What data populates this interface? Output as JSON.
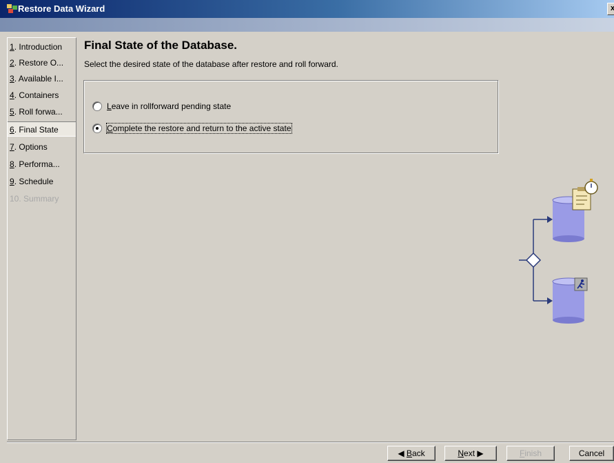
{
  "window": {
    "title": "Restore Data Wizard",
    "close_glyph": "x"
  },
  "nav": {
    "items": [
      {
        "num": "1",
        "rest": ". Introduction",
        "state": "normal"
      },
      {
        "num": "2",
        "rest": ". Restore O...",
        "state": "normal"
      },
      {
        "num": "3",
        "rest": ". Available I...",
        "state": "normal"
      },
      {
        "num": "4",
        "rest": ". Containers",
        "state": "normal"
      },
      {
        "num": "5",
        "rest": ". Roll forwa...",
        "state": "normal"
      },
      {
        "num": "6",
        "rest": ". Final State",
        "state": "selected"
      },
      {
        "num": "7",
        "rest": ". Options",
        "state": "normal"
      },
      {
        "num": "8",
        "rest": ". Performa...",
        "state": "normal"
      },
      {
        "num": "9",
        "rest": ". Schedule",
        "state": "normal"
      },
      {
        "num": "",
        "rest": "10. Summary",
        "state": "disabled"
      }
    ]
  },
  "page": {
    "heading": "Final State of the Database.",
    "subtitle": "Select the desired state of the database after restore and roll forward."
  },
  "options": {
    "leave": {
      "key": "L",
      "rest": "eave in rollforward pending state",
      "checked": false
    },
    "complete": {
      "key": "C",
      "rest": "omplete the restore and return to the active state",
      "checked": true
    }
  },
  "buttons": {
    "back": {
      "prefix": "◀ ",
      "key": "B",
      "rest": "ack"
    },
    "next": {
      "key": "N",
      "rest": "ext ▶"
    },
    "finish": {
      "key": "F",
      "rest": "inish"
    },
    "cancel": {
      "label": "Cancel"
    }
  },
  "colors": {
    "cylinder": "#9a9be6",
    "cylinder_dark": "#6c6dc0",
    "arrow": "#2a3a7a"
  },
  "icons": [
    "app-icon",
    "stopwatch-icon",
    "clipboard-icon",
    "running-man-icon",
    "database-icon"
  ]
}
